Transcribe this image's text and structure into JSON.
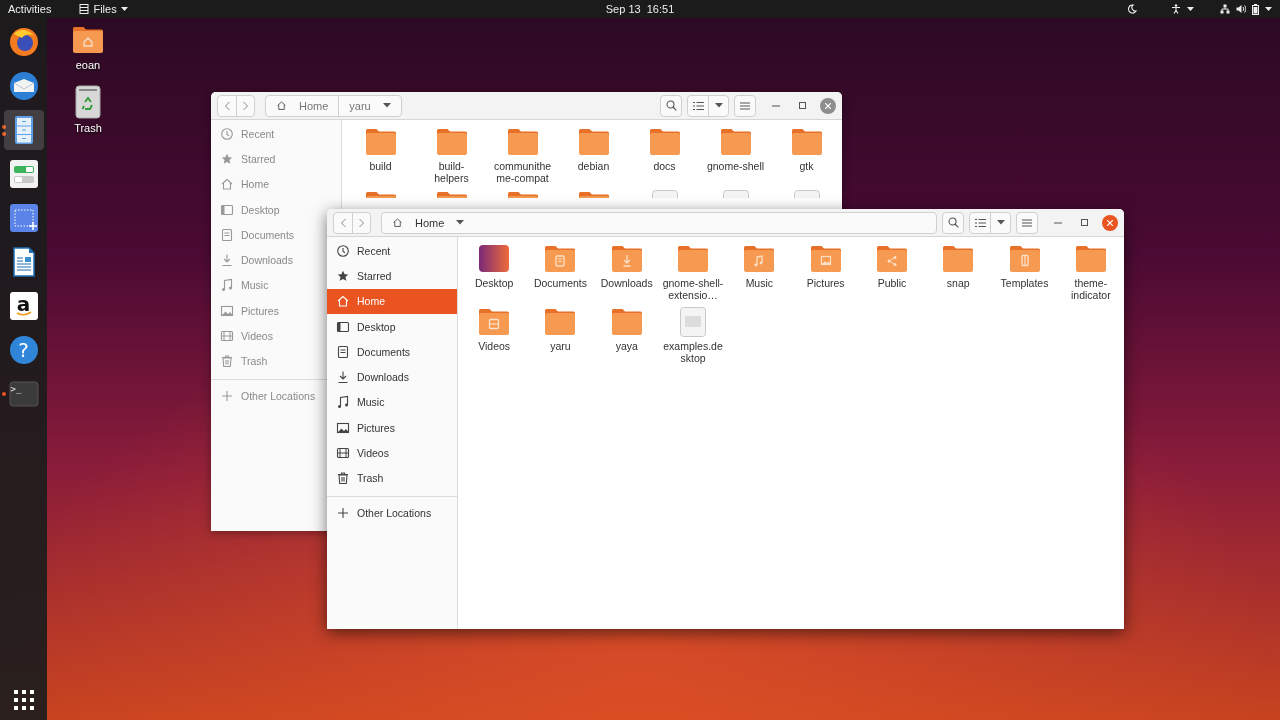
{
  "top_bar": {
    "activities": "Activities",
    "app_menu": "Files",
    "clock": "Sep 13  16:51"
  },
  "dock": {
    "apps": [
      {
        "kind": "browser",
        "focused": false,
        "running": false,
        "multiple_windows": false
      },
      {
        "kind": "mail",
        "focused": false,
        "running": false,
        "multiple_windows": false
      },
      {
        "kind": "files",
        "focused": true,
        "running": true,
        "multiple_windows": true
      },
      {
        "kind": "tweaks",
        "focused": false,
        "running": false,
        "multiple_windows": false
      },
      {
        "kind": "screenshot",
        "focused": false,
        "running": false,
        "multiple_windows": false
      },
      {
        "kind": "writer",
        "focused": false,
        "running": false,
        "multiple_windows": false
      },
      {
        "kind": "store",
        "glyph": "a",
        "focused": false,
        "running": false,
        "multiple_windows": false
      },
      {
        "kind": "help",
        "glyph": "?",
        "focused": false,
        "running": false,
        "multiple_windows": false
      },
      {
        "kind": "terminal",
        "glyph": ">_",
        "focused": false,
        "running": true,
        "multiple_windows": false
      }
    ]
  },
  "desktop_icons": [
    {
      "kind": "home",
      "label": "eoan"
    },
    {
      "kind": "trash",
      "label": "Trash"
    }
  ],
  "windows": [
    {
      "focused": false,
      "path": [
        {
          "kind": "home",
          "label": "Home"
        },
        {
          "kind": "folder",
          "label": "yaru"
        }
      ],
      "sidebar": [
        {
          "kind": "recent",
          "label": "Recent",
          "selected": false
        },
        {
          "kind": "starred",
          "label": "Starred",
          "selected": false
        },
        {
          "kind": "home",
          "label": "Home",
          "selected": false
        },
        {
          "kind": "desktop",
          "label": "Desktop",
          "selected": false
        },
        {
          "kind": "documents",
          "label": "Documents",
          "selected": false
        },
        {
          "kind": "downloads",
          "label": "Downloads",
          "selected": false
        },
        {
          "kind": "music",
          "label": "Music",
          "selected": false
        },
        {
          "kind": "pictures",
          "label": "Pictures",
          "selected": false
        },
        {
          "kind": "videos",
          "label": "Videos",
          "selected": false
        },
        {
          "kind": "trash",
          "label": "Trash",
          "selected": false
        },
        {
          "kind": "other",
          "label": "Other Locations",
          "selected": false
        }
      ],
      "items": [
        {
          "kind": "folder",
          "label": "build"
        },
        {
          "kind": "folder",
          "label": "build-helpers"
        },
        {
          "kind": "folder",
          "label": "communitheme-compat"
        },
        {
          "kind": "folder",
          "label": "debian"
        },
        {
          "kind": "folder",
          "label": "docs"
        },
        {
          "kind": "folder",
          "label": "gnome-shell"
        },
        {
          "kind": "folder",
          "label": "gtk"
        },
        {
          "kind": "folder"
        },
        {
          "kind": "folder"
        },
        {
          "kind": "folder"
        },
        {
          "kind": "folder"
        },
        {
          "kind": "file"
        },
        {
          "kind": "file"
        },
        {
          "kind": "file"
        }
      ]
    },
    {
      "focused": true,
      "path": [
        {
          "kind": "home",
          "label": "Home"
        }
      ],
      "sidebar": [
        {
          "kind": "recent",
          "label": "Recent",
          "selected": false
        },
        {
          "kind": "starred",
          "label": "Starred",
          "selected": false
        },
        {
          "kind": "home",
          "label": "Home",
          "selected": true
        },
        {
          "kind": "desktop",
          "label": "Desktop",
          "selected": false
        },
        {
          "kind": "documents",
          "label": "Documents",
          "selected": false
        },
        {
          "kind": "downloads",
          "label": "Downloads",
          "selected": false
        },
        {
          "kind": "music",
          "label": "Music",
          "selected": false
        },
        {
          "kind": "pictures",
          "label": "Pictures",
          "selected": false
        },
        {
          "kind": "videos",
          "label": "Videos",
          "selected": false
        },
        {
          "kind": "trash",
          "label": "Trash",
          "selected": false
        },
        {
          "kind": "other",
          "label": "Other Locations",
          "selected": false
        }
      ],
      "items": [
        {
          "kind": "desktop",
          "label": "Desktop"
        },
        {
          "kind": "documents",
          "label": "Documents"
        },
        {
          "kind": "downloads",
          "label": "Downloads"
        },
        {
          "kind": "folder",
          "label": "gnome-shell-extensio…"
        },
        {
          "kind": "music",
          "label": "Music"
        },
        {
          "kind": "pictures",
          "label": "Pictures"
        },
        {
          "kind": "public",
          "label": "Public"
        },
        {
          "kind": "folder",
          "label": "snap"
        },
        {
          "kind": "templates",
          "label": "Templates"
        },
        {
          "kind": "folder",
          "label": "theme-indicator"
        },
        {
          "kind": "videos",
          "label": "Videos"
        },
        {
          "kind": "folder",
          "label": "yaru"
        },
        {
          "kind": "folder",
          "label": "yaya"
        },
        {
          "kind": "file",
          "label": "examples.desktop"
        }
      ]
    }
  ]
}
